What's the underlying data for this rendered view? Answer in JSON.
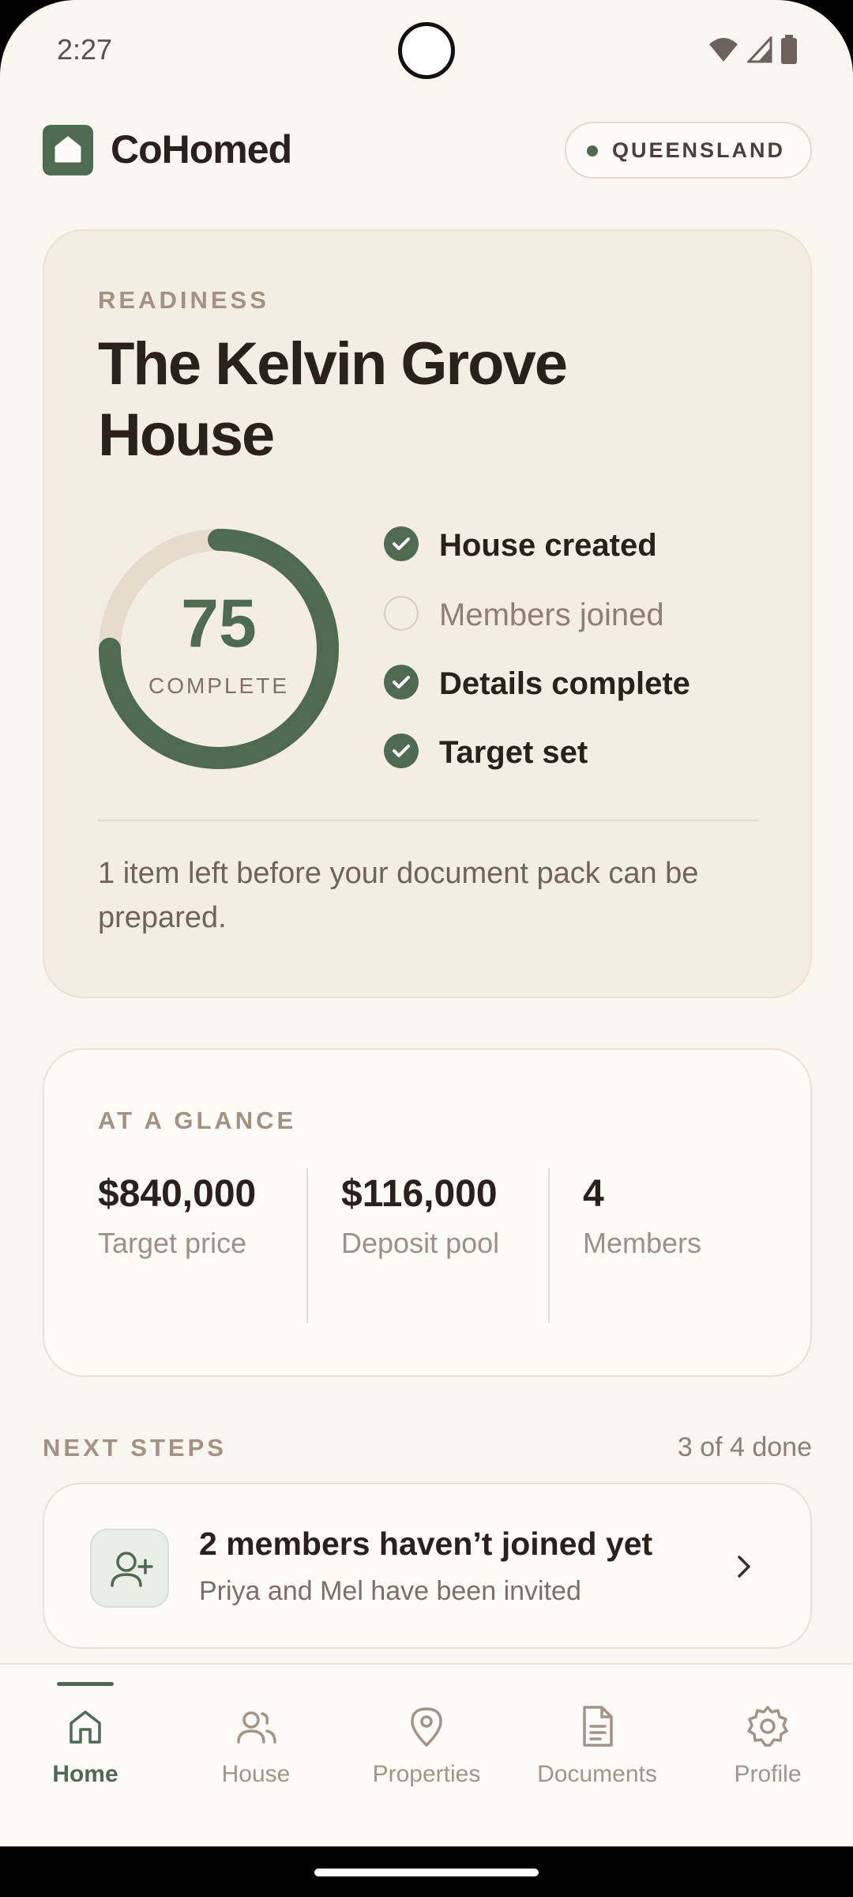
{
  "status_bar": {
    "time": "2:27"
  },
  "header": {
    "brand": "CoHomed",
    "region": "QUEENSLAND"
  },
  "readiness": {
    "eyebrow": "READINESS",
    "house_name": "The Kelvin Grove House",
    "percent": 75,
    "percent_label": "COMPLETE",
    "checklist": [
      {
        "label": "House created",
        "done": true
      },
      {
        "label": "Members joined",
        "done": false
      },
      {
        "label": "Details complete",
        "done": true
      },
      {
        "label": "Target set",
        "done": true
      }
    ],
    "note": "1 item left before your document pack can be prepared."
  },
  "glance": {
    "eyebrow": "AT A GLANCE",
    "stats": [
      {
        "value": "$840,000",
        "caption": "Target price"
      },
      {
        "value": "$116,000",
        "caption": "Deposit pool"
      },
      {
        "value": "4",
        "caption": "Members"
      }
    ]
  },
  "next_steps": {
    "eyebrow": "NEXT STEPS",
    "progress": "3 of 4 done",
    "items": [
      {
        "title": "2 members haven’t joined yet",
        "subtitle": "Priya and Mel have been invited",
        "icon": "user-plus-icon"
      }
    ]
  },
  "nav": {
    "items": [
      {
        "label": "Home",
        "icon": "home-icon",
        "active": true
      },
      {
        "label": "House",
        "icon": "users-icon",
        "active": false
      },
      {
        "label": "Properties",
        "icon": "map-pin-icon",
        "active": false
      },
      {
        "label": "Documents",
        "icon": "document-icon",
        "active": false
      },
      {
        "label": "Profile",
        "icon": "gear-icon",
        "active": false
      }
    ]
  },
  "colors": {
    "accent": "#4e6b52",
    "background": "#f9f6ef",
    "card": "#f4ede2",
    "ring_track": "#e5dccd"
  }
}
